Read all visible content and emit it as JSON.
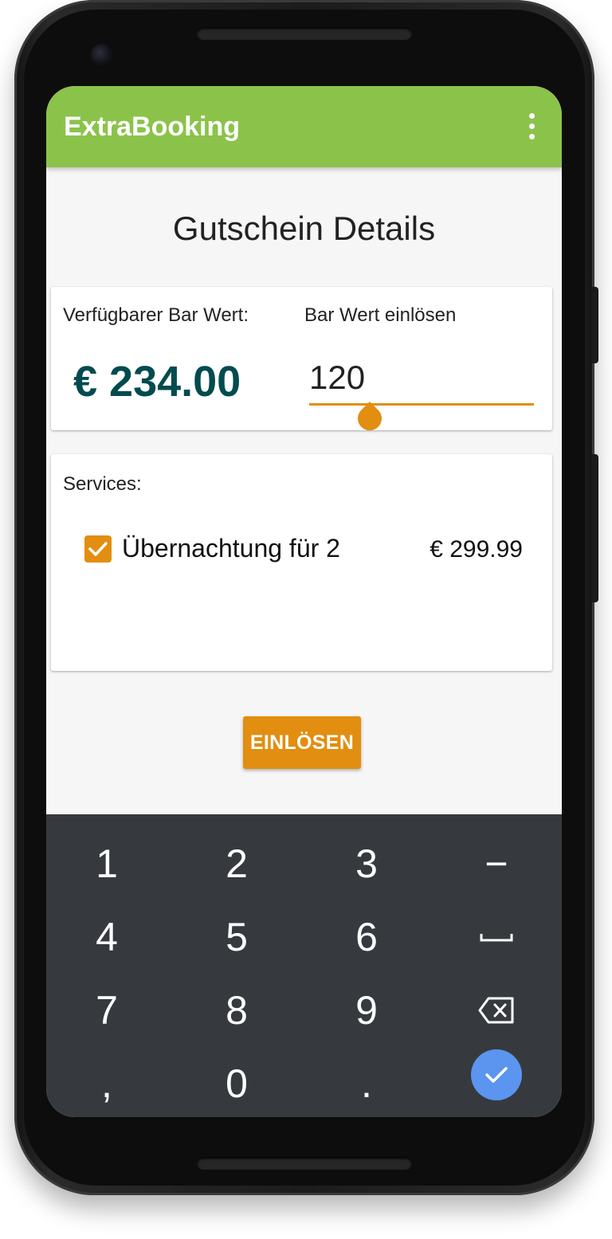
{
  "app": {
    "title": "ExtraBooking",
    "menu_icon": "more-vert-icon"
  },
  "page": {
    "title": "Gutschein Details"
  },
  "value_card": {
    "available_label": "Verfügbarer Bar Wert:",
    "available_amount": "€ 234.00",
    "redeem_label": "Bar Wert einlösen",
    "redeem_value": "120"
  },
  "services_card": {
    "label": "Services:",
    "items": [
      {
        "name": "Übernachtung für 2",
        "price": "€ 299.99",
        "checked": true
      }
    ]
  },
  "actions": {
    "redeem_button": "EINLÖSEN"
  },
  "keyboard": {
    "keys": [
      "1",
      "2",
      "3",
      "−",
      "4",
      "5",
      "6",
      "␣",
      "7",
      "8",
      "9",
      "⌫",
      ",",
      "0",
      ".",
      "✓"
    ],
    "special_icons": {
      "space": "space-icon",
      "backspace": "backspace-icon",
      "done": "check-icon"
    }
  },
  "colors": {
    "appbar": "#8bc34a",
    "accent": "#e28e10",
    "amount": "#024b4f",
    "keyboard_bg": "#363a3e",
    "done_key": "#5b95f0"
  }
}
